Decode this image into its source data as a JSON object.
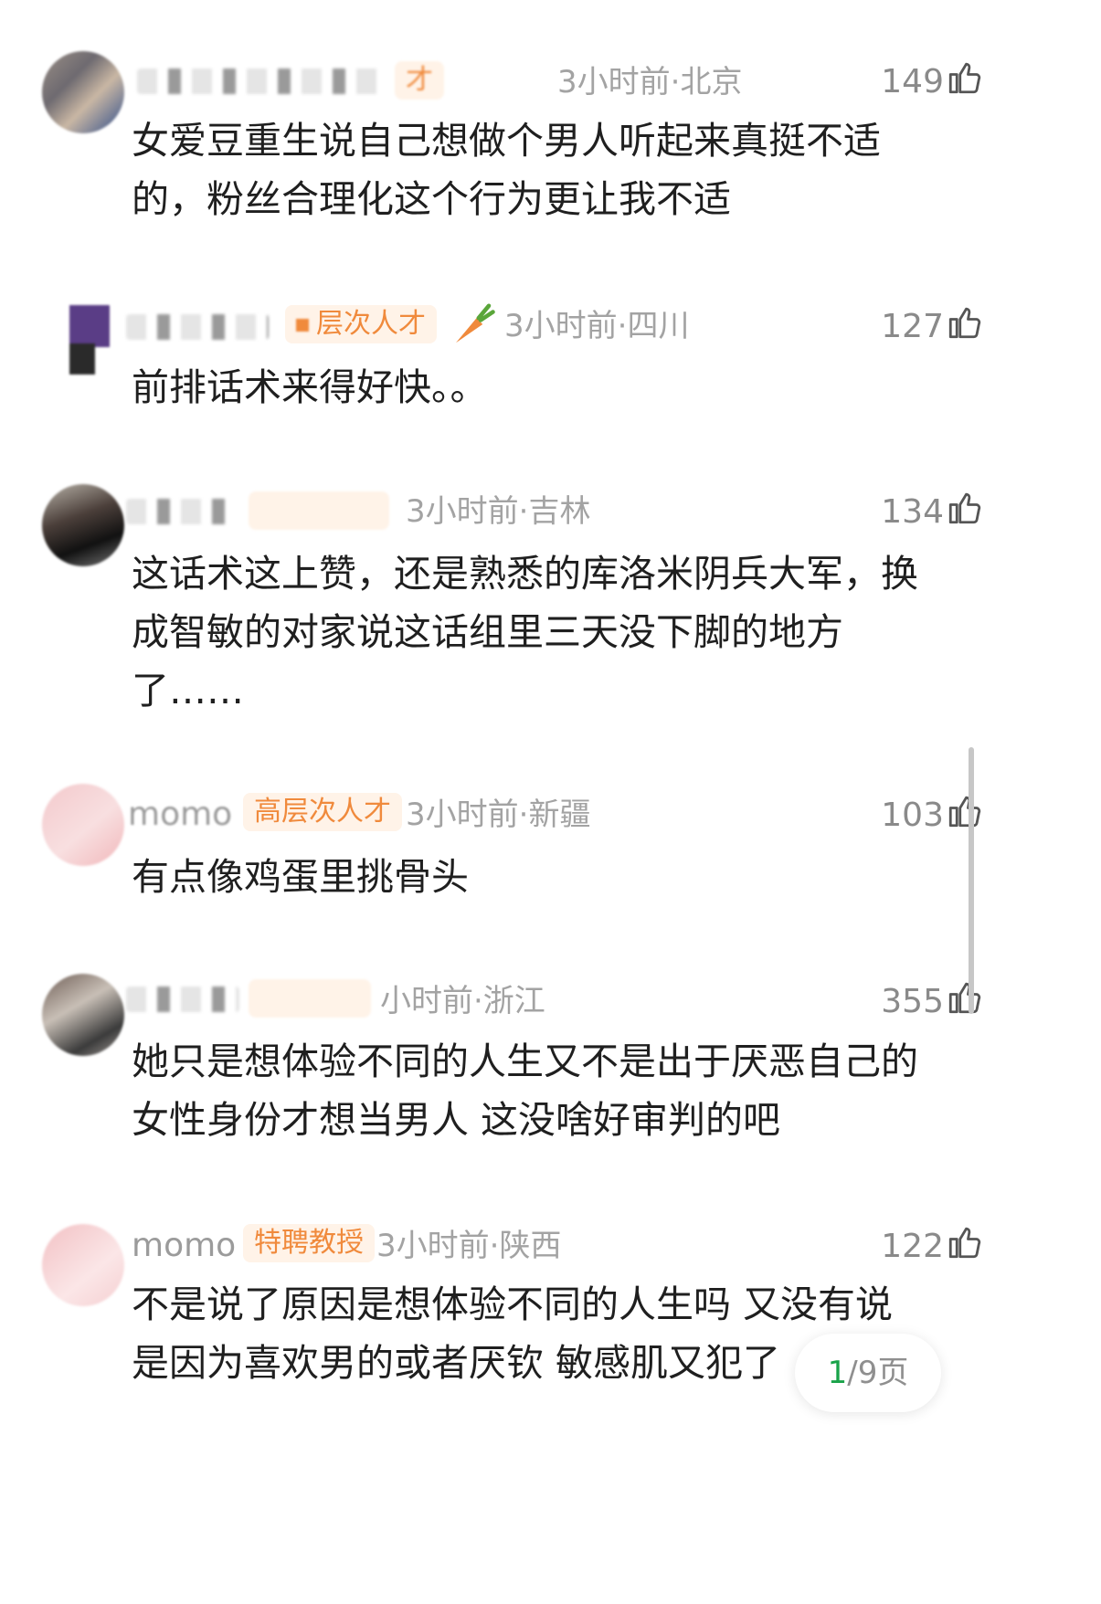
{
  "comments": [
    {
      "username": "",
      "badge": "才",
      "meta": "3小时前·北京",
      "likes": "149",
      "text": "女爱豆重生说自己想做个男人听起来真挺不适\n的，粉丝合理化这个行为更让我不适"
    },
    {
      "username": "",
      "badge": "层次人才",
      "meta": "3小时前·四川",
      "likes": "127",
      "text": "前排话术来得好快。。"
    },
    {
      "username": "",
      "badge": "",
      "meta": "3小时前·吉林",
      "likes": "134",
      "text": "这话术这上赞，还是熟悉的库洛米阴兵大军，换\n成智敏的对家说这话组里三天没下脚的地方\n了……"
    },
    {
      "username": "momo",
      "badge": "高层次人才",
      "meta": "3小时前·新疆",
      "likes": "103",
      "text": "有点像鸡蛋里挑骨头"
    },
    {
      "username": "",
      "badge": "",
      "meta": "小时前·浙江",
      "likes": "355",
      "text": "她只是想体验不同的人生又不是出于厌恶自己的\n女性身份才想当男人 这没啥好审判的吧"
    },
    {
      "username": "momo",
      "badge": "特聘教授",
      "meta": "3小时前·陕西",
      "likes": "122",
      "text": "不是说了原因是想体验不同的人生吗 又没有说\n是因为喜欢男的或者厌钦 敏感肌又犯了"
    }
  ],
  "pager": {
    "current": "1",
    "total_label": "/9页"
  },
  "icons": {
    "like": "thumbs-up-icon",
    "carrot": "carrot-icon"
  },
  "colors": {
    "badge_text": "#f08a3c",
    "badge_bg": "#fff3e8",
    "pager_current": "#1aa34a"
  }
}
